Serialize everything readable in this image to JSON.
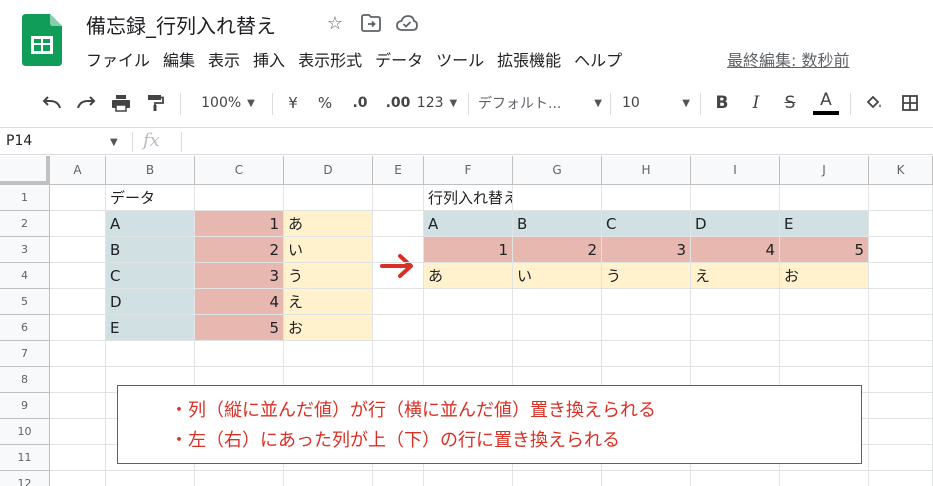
{
  "doc": {
    "title": "備忘録_行列入れ替え",
    "menu": [
      "ファイル",
      "編集",
      "表示",
      "挿入",
      "表示形式",
      "データ",
      "ツール",
      "拡張機能",
      "ヘルプ"
    ],
    "last_edit": "最終編集: 数秒前"
  },
  "toolbar": {
    "zoom": "100%",
    "currency": "¥",
    "percent": "%",
    "dec_decrease": ".0",
    "dec_increase": ".00",
    "format_more": "123",
    "font": "デフォルト...",
    "font_size": "10",
    "bold": "B",
    "italic": "I",
    "strike": "S",
    "text_color": "A"
  },
  "formula_bar": {
    "name_box": "P14",
    "fx": "fx",
    "value": ""
  },
  "columns": [
    "A",
    "B",
    "C",
    "D",
    "E",
    "F",
    "G",
    "H",
    "I",
    "J",
    "K"
  ],
  "rows": [
    "1",
    "2",
    "3",
    "4",
    "5",
    "6",
    "7",
    "8",
    "9",
    "10",
    "11",
    "12"
  ],
  "colors": {
    "blue": "#d0e0e3",
    "red": "#e6b8af",
    "yellow": "#fff2cc",
    "accent": "#d93025",
    "sheets_green": "#0f9d58"
  },
  "cells": [
    {
      "ref": "B1",
      "v": "データ"
    },
    {
      "ref": "B2",
      "v": "A",
      "bg": "blue"
    },
    {
      "ref": "C2",
      "v": "1",
      "bg": "red",
      "num": true
    },
    {
      "ref": "D2",
      "v": "あ",
      "bg": "yellow"
    },
    {
      "ref": "B3",
      "v": "B",
      "bg": "blue"
    },
    {
      "ref": "C3",
      "v": "2",
      "bg": "red",
      "num": true
    },
    {
      "ref": "D3",
      "v": "い",
      "bg": "yellow"
    },
    {
      "ref": "B4",
      "v": "C",
      "bg": "blue"
    },
    {
      "ref": "C4",
      "v": "3",
      "bg": "red",
      "num": true
    },
    {
      "ref": "D4",
      "v": "う",
      "bg": "yellow"
    },
    {
      "ref": "B5",
      "v": "D",
      "bg": "blue"
    },
    {
      "ref": "C5",
      "v": "4",
      "bg": "red",
      "num": true
    },
    {
      "ref": "D5",
      "v": "え",
      "bg": "yellow"
    },
    {
      "ref": "B6",
      "v": "E",
      "bg": "blue"
    },
    {
      "ref": "C6",
      "v": "5",
      "bg": "red",
      "num": true
    },
    {
      "ref": "D6",
      "v": "お",
      "bg": "yellow"
    },
    {
      "ref": "F1",
      "v": "行列入れ替え後"
    },
    {
      "ref": "F2",
      "v": "A",
      "bg": "blue"
    },
    {
      "ref": "G2",
      "v": "B",
      "bg": "blue"
    },
    {
      "ref": "H2",
      "v": "C",
      "bg": "blue"
    },
    {
      "ref": "I2",
      "v": "D",
      "bg": "blue"
    },
    {
      "ref": "J2",
      "v": "E",
      "bg": "blue"
    },
    {
      "ref": "F3",
      "v": "1",
      "bg": "red",
      "num": true
    },
    {
      "ref": "G3",
      "v": "2",
      "bg": "red",
      "num": true
    },
    {
      "ref": "H3",
      "v": "3",
      "bg": "red",
      "num": true
    },
    {
      "ref": "I3",
      "v": "4",
      "bg": "red",
      "num": true
    },
    {
      "ref": "J3",
      "v": "5",
      "bg": "red",
      "num": true
    },
    {
      "ref": "F4",
      "v": "あ",
      "bg": "yellow"
    },
    {
      "ref": "G4",
      "v": "い",
      "bg": "yellow"
    },
    {
      "ref": "H4",
      "v": "う",
      "bg": "yellow"
    },
    {
      "ref": "I4",
      "v": "え",
      "bg": "yellow"
    },
    {
      "ref": "J4",
      "v": "お",
      "bg": "yellow"
    }
  ],
  "note": {
    "line1": "・列（縦に並んだ値）が行（横に並んだ値）置き換えられる",
    "line2": "・左（右）にあった列が上（下）の行に置き換えられる"
  }
}
